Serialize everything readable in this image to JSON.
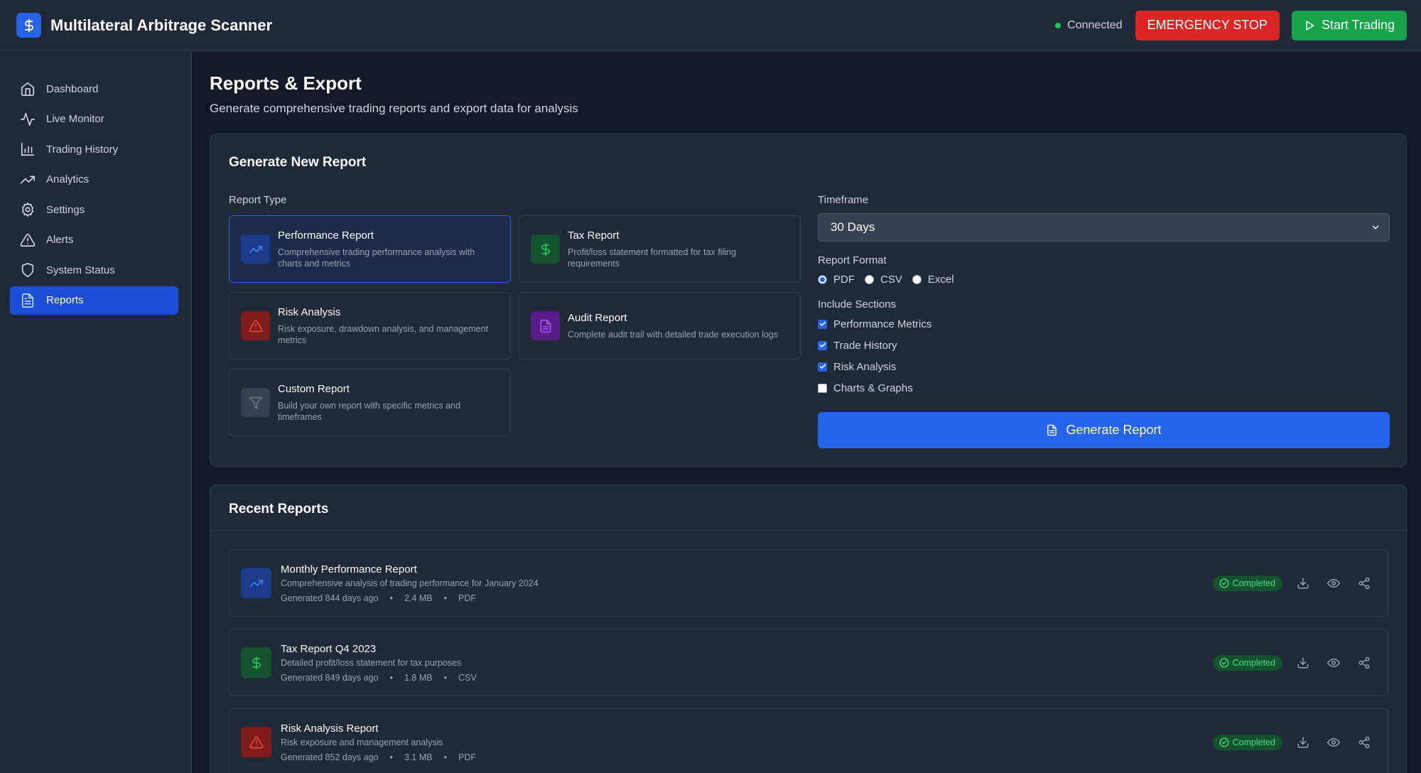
{
  "header": {
    "title": "Multilateral Arbitrage Scanner",
    "status": "Connected",
    "emergency_label": "EMERGENCY STOP",
    "start_label": "Start Trading"
  },
  "sidebar": {
    "items": [
      {
        "label": "Dashboard",
        "icon": "home-icon"
      },
      {
        "label": "Live Monitor",
        "icon": "activity-icon"
      },
      {
        "label": "Trading History",
        "icon": "bar-chart-icon"
      },
      {
        "label": "Analytics",
        "icon": "trending-up-icon"
      },
      {
        "label": "Settings",
        "icon": "gear-icon"
      },
      {
        "label": "Alerts",
        "icon": "alert-triangle-icon"
      },
      {
        "label": "System Status",
        "icon": "shield-icon"
      },
      {
        "label": "Reports",
        "icon": "file-text-icon",
        "active": true
      }
    ]
  },
  "page": {
    "title": "Reports & Export",
    "subtitle": "Generate comprehensive trading reports and export data for analysis"
  },
  "generate": {
    "title": "Generate New Report",
    "report_type_label": "Report Type",
    "types": [
      {
        "name": "Performance Report",
        "desc": "Comprehensive trading performance analysis with charts and metrics",
        "icon": "trending-up-icon",
        "selected": true
      },
      {
        "name": "Tax Report",
        "desc": "Profit/loss statement formatted for tax filing requirements",
        "icon": "dollar-icon"
      },
      {
        "name": "Risk Analysis",
        "desc": "Risk exposure, drawdown analysis, and management metrics",
        "icon": "alert-triangle-icon"
      },
      {
        "name": "Audit Report",
        "desc": "Complete audit trail with detailed trade execution logs",
        "icon": "file-text-icon"
      },
      {
        "name": "Custom Report",
        "desc": "Build your own report with specific metrics and timeframes",
        "icon": "filter-icon"
      }
    ],
    "timeframe_label": "Timeframe",
    "timeframe_value": "30 Days",
    "format_label": "Report Format",
    "formats": [
      {
        "label": "PDF",
        "checked": true
      },
      {
        "label": "CSV",
        "checked": false
      },
      {
        "label": "Excel",
        "checked": false
      }
    ],
    "sections_label": "Include Sections",
    "sections": [
      {
        "label": "Performance Metrics",
        "checked": true
      },
      {
        "label": "Trade History",
        "checked": true
      },
      {
        "label": "Risk Analysis",
        "checked": true
      },
      {
        "label": "Charts & Graphs",
        "checked": false
      }
    ],
    "generate_label": "Generate Report"
  },
  "recent": {
    "title": "Recent Reports",
    "reports": [
      {
        "name": "Monthly Performance Report",
        "desc": "Comprehensive analysis of trading performance for January 2024",
        "generated": "Generated 844 days ago",
        "size": "2.4 MB",
        "format": "PDF",
        "status": "Completed",
        "icon": "trending-up-icon"
      },
      {
        "name": "Tax Report Q4 2023",
        "desc": "Detailed profit/loss statement for tax purposes",
        "generated": "Generated 849 days ago",
        "size": "1.8 MB",
        "format": "CSV",
        "status": "Completed",
        "icon": "dollar-icon"
      },
      {
        "name": "Risk Analysis Report",
        "desc": "Risk exposure and management analysis",
        "generated": "Generated 852 days ago",
        "size": "3.1 MB",
        "format": "PDF",
        "status": "Completed",
        "icon": "alert-triangle-icon"
      }
    ],
    "separator": "•"
  },
  "colors": {
    "accent": "#2563eb",
    "emergency": "#dc2626",
    "start": "#16a34a",
    "completed": "#4ade80"
  }
}
